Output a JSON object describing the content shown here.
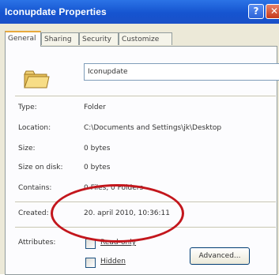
{
  "window": {
    "title": "Iconupdate Properties",
    "help_glyph": "?",
    "close_glyph": "✕"
  },
  "tabs": [
    {
      "label": "General",
      "active": true
    },
    {
      "label": "Sharing",
      "active": false
    },
    {
      "label": "Security",
      "active": false
    },
    {
      "label": "Customize",
      "active": false
    }
  ],
  "general": {
    "folder_icon": "folder-icon",
    "name_value": "Iconupdate",
    "fields": [
      {
        "label": "Type:",
        "value": "Folder"
      },
      {
        "label": "Location:",
        "value": "C:\\Documents and Settings\\jk\\Desktop"
      },
      {
        "label": "Size:",
        "value": "0 bytes"
      },
      {
        "label": "Size on disk:",
        "value": "0 bytes"
      },
      {
        "label": "Contains:",
        "value": "0 Files, 0 Folders"
      }
    ],
    "created": {
      "label": "Created:",
      "value": "20. april 2010, 10:36:11"
    },
    "attributes": {
      "label": "Attributes:",
      "read_only": {
        "label": "Read-only",
        "checked": false
      },
      "hidden": {
        "label": "Hidden",
        "checked": false
      },
      "advanced_label": "Advanced..."
    }
  },
  "colors": {
    "titlebar": "#1554d0",
    "dialog_face": "#ece9d8",
    "highlight_ring": "#c3161c"
  }
}
